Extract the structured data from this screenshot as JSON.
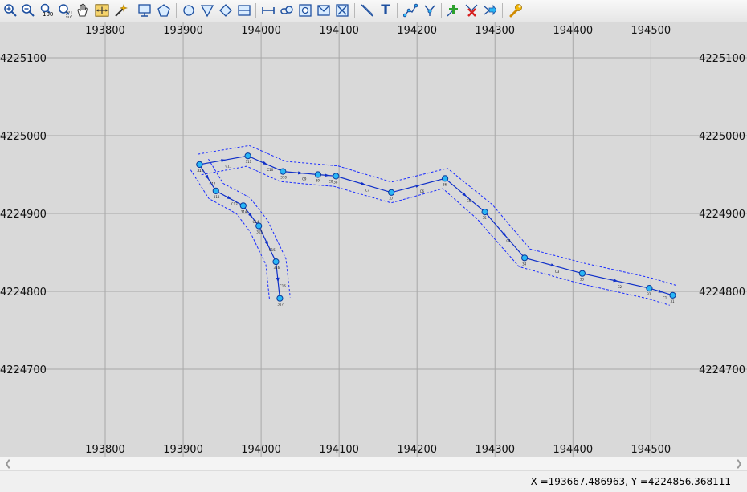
{
  "toolbar": {
    "zoom_100_label": "100",
    "text_tool_label": "T"
  },
  "map": {
    "x_ticks": [
      "193800",
      "193900",
      "194000",
      "194100",
      "194200",
      "194300",
      "194400",
      "194500"
    ],
    "y_ticks": [
      "4225100",
      "4225000",
      "4224900",
      "4224800",
      "4224700"
    ],
    "route_main": {
      "line_color": "#1030c8",
      "buffer_color": "#1a2cff",
      "vertex_color": "#29b6f6",
      "vertices": [
        {
          "x": 193921,
          "y": 4224963,
          "label": "311"
        },
        {
          "x": 193983,
          "y": 4224974,
          "label": "311"
        },
        {
          "x": 194028,
          "y": 4224954,
          "label": "310"
        },
        {
          "x": 194073,
          "y": 4224950,
          "label": "39"
        },
        {
          "x": 194096,
          "y": 4224948,
          "label": "38"
        },
        {
          "x": 194167,
          "y": 4224927,
          "label": "37"
        },
        {
          "x": 194236,
          "y": 4224945,
          "label": "36"
        },
        {
          "x": 194287,
          "y": 4224902,
          "label": "35"
        },
        {
          "x": 194338,
          "y": 4224843,
          "label": "34"
        },
        {
          "x": 194412,
          "y": 4224823,
          "label": "33"
        },
        {
          "x": 194498,
          "y": 4224804,
          "label": "32"
        },
        {
          "x": 194528,
          "y": 4224795,
          "label": "31"
        }
      ],
      "segment_labels": [
        "C11",
        "C10",
        "C9",
        "C8",
        "C7",
        "C6",
        "C5",
        "C4",
        "C3",
        "C2",
        "C1"
      ]
    },
    "route_branch": {
      "vertices": [
        {
          "x": 193921,
          "y": 4224963,
          "label": "312"
        },
        {
          "x": 193942,
          "y": 4224929,
          "label": "313"
        },
        {
          "x": 193977,
          "y": 4224910,
          "label": "314"
        },
        {
          "x": 193997,
          "y": 4224884,
          "label": "315"
        },
        {
          "x": 194019,
          "y": 4224838,
          "label": "316"
        },
        {
          "x": 194024,
          "y": 4224791,
          "label": "317"
        }
      ],
      "segment_labels": [
        "C12",
        "C13",
        "C14",
        "C15",
        "C16"
      ]
    }
  },
  "status_bar": {
    "coords": "X =193667.486963, Y =4224856.368111"
  }
}
